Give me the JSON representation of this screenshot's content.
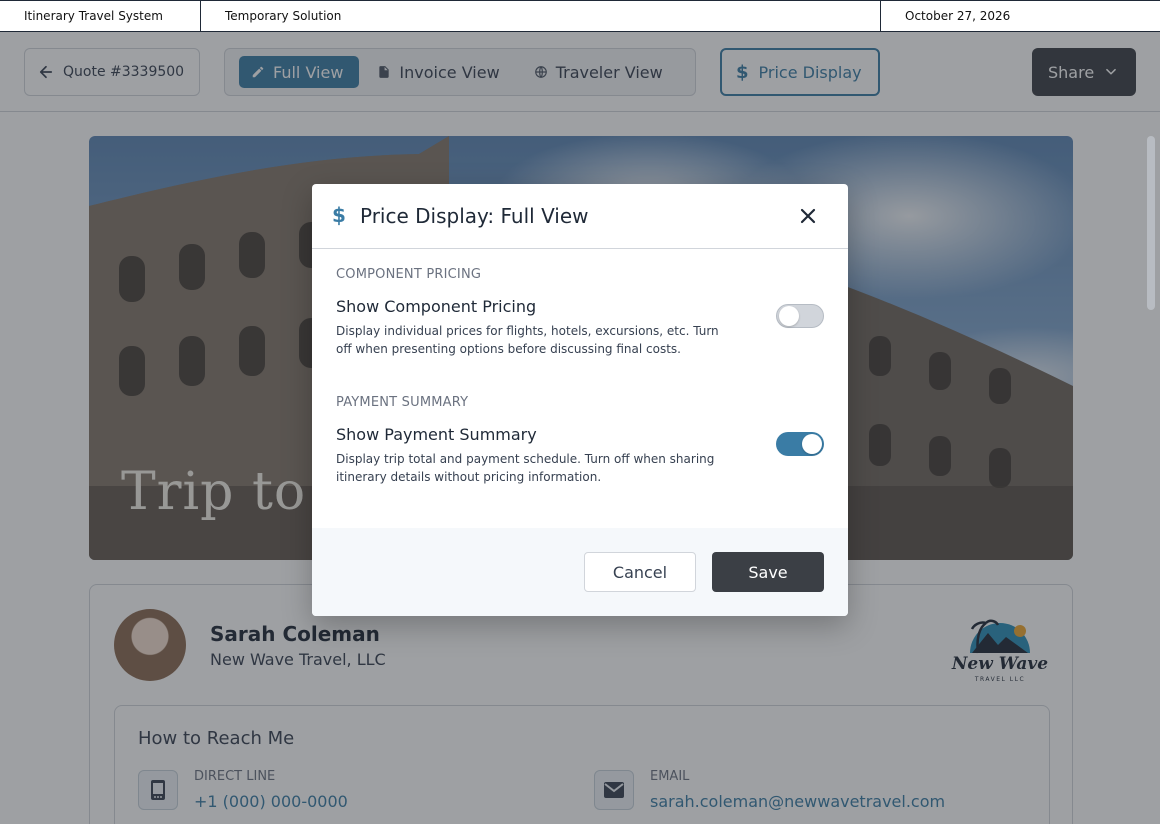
{
  "topbar": {
    "app_name": "Itinerary Travel System",
    "environment": "Temporary Solution",
    "date": "October 27, 2026"
  },
  "toolbar": {
    "back_label": "Quote #3339500",
    "views": [
      {
        "label": "Full View",
        "icon": "pencil-icon",
        "active": true
      },
      {
        "label": "Invoice View",
        "icon": "document-icon",
        "active": false
      },
      {
        "label": "Traveler View",
        "icon": "globe-icon",
        "active": false
      }
    ],
    "price_display_label": "Price Display",
    "share_label": "Share"
  },
  "hero": {
    "title": "Trip to R"
  },
  "agent": {
    "name": "Sarah Coleman",
    "company": "New Wave Travel, LLC",
    "logo_text": "New Wave",
    "logo_sub": "TRAVEL LLC"
  },
  "contact": {
    "title": "How to Reach Me",
    "phone_label": "DIRECT LINE",
    "phone_value": "+1 (000) 000-0000",
    "email_label": "EMAIL",
    "email_value": "sarah.coleman@newwavetravel.com"
  },
  "modal": {
    "title": "Price Display: Full View",
    "sections": [
      {
        "heading": "COMPONENT PRICING",
        "setting_title": "Show Component Pricing",
        "description": "Display individual prices for flights, hotels, excursions, etc. Turn off when presenting options before discussing final costs.",
        "enabled": false
      },
      {
        "heading": "PAYMENT SUMMARY",
        "setting_title": "Show Payment Summary",
        "description": "Display trip total and payment schedule. Turn off when sharing itinerary details without pricing information.",
        "enabled": true
      }
    ],
    "cancel_label": "Cancel",
    "save_label": "Save"
  },
  "colors": {
    "accent": "#3a7ca5",
    "dark_button": "#3b3f45"
  }
}
